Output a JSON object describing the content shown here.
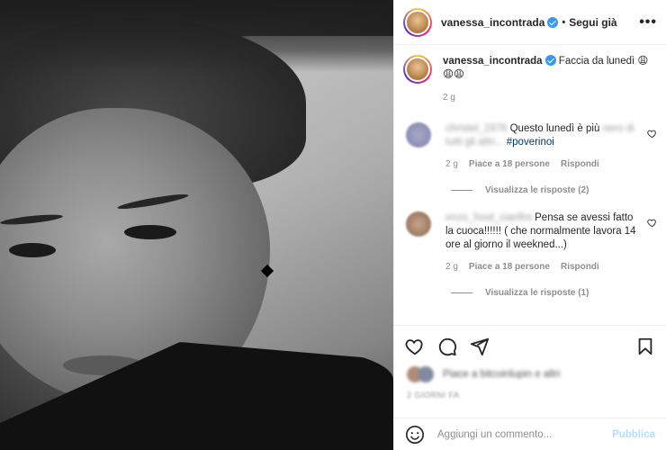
{
  "post": {
    "username": "vanessa_incontrada",
    "follow_label": "Segui già",
    "separator": "•",
    "more_icon": "more-horizontal-icon"
  },
  "caption": {
    "username": "vanessa_incontrada",
    "text": "Faccia da lunedì",
    "emojis": [
      "😩",
      "😩",
      "😩"
    ],
    "time": "2 g"
  },
  "comments": [
    {
      "username": "christel_1976",
      "text_visible": "Questo lunedì è più",
      "text_blurred": "nero di tutti gli altri...",
      "hashtag": "#poverinoi",
      "time": "2 g",
      "likes": "Piace a 18 persone",
      "reply": "Rispondi",
      "view_replies": "Visualizza le risposte (2)"
    },
    {
      "username": "enzo_food_cianfini",
      "text_visible": "Pensa se",
      "text_blurred": "avessi fatto la cuoca!!!!!! ( che normalmente lavora 14 ore al giorno il weekned...)",
      "time": "2 g",
      "likes": "Piace a 18 persone",
      "reply": "Rispondi",
      "view_replies": "Visualizza le risposte (1)"
    }
  ],
  "likes_summary": "Piace a bitcoinlupin e altri",
  "date": "2 GIORNI FA",
  "composer": {
    "placeholder": "Aggiungi un commento...",
    "publish": "Pubblica"
  },
  "colors": {
    "verified": "#3897f0",
    "link": "#00376b",
    "publish_disabled": "#b2dffc",
    "secondary_text": "#8e8e8e"
  }
}
